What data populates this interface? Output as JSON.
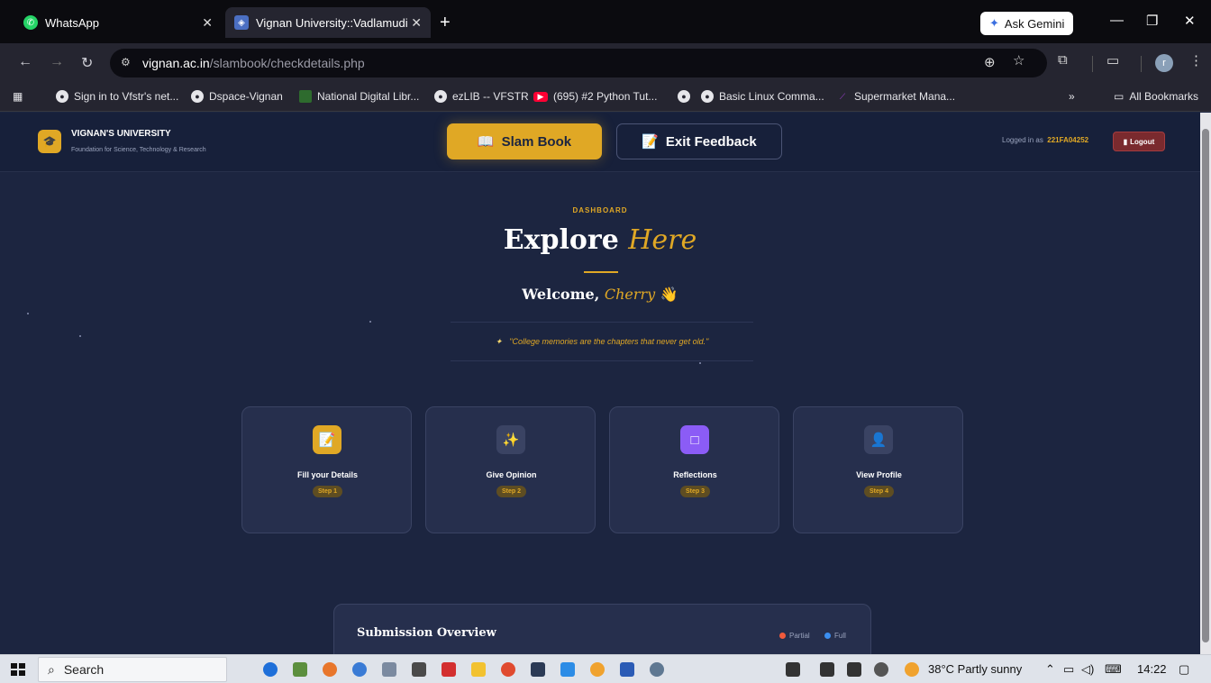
{
  "browser": {
    "tabs": [
      {
        "title": "WhatsApp"
      },
      {
        "title": "Vignan University::Vadlamudi"
      }
    ],
    "gemini_label": "Ask Gemini",
    "url_host": "vignan.ac.in",
    "url_path": "/slambook/checkdetails.php",
    "profile_initial": "r",
    "bookmarks": [
      "Sign in to Vfstr's net...",
      "Dspace-Vignan",
      "National Digital Libr...",
      "ezLIB -- VFSTR",
      "(695) #2 Python Tut...",
      "Basic Linux Comma...",
      "Supermarket Mana..."
    ],
    "all_bookmarks": "All Bookmarks"
  },
  "header": {
    "uni_name": "VIGNAN'S UNIVERSITY",
    "uni_sub": "Foundation for Science, Technology & Research",
    "slam_label": "Slam Book",
    "exit_label": "Exit Feedback",
    "logged_prefix": "Logged in as",
    "user_id": "221FA04252",
    "logout_label": "Logout"
  },
  "hero": {
    "kicker": "DASHBOARD",
    "title_main": "Explore",
    "title_accent": "Here",
    "welcome_prefix": "Welcome,",
    "welcome_name": "Cherry",
    "welcome_emoji": "👋",
    "quote": "\"College memories are the chapters that never get old.\""
  },
  "cards": [
    {
      "title": "Fill your Details",
      "step": "Step 1",
      "icon": "📝",
      "color": "#e0a825"
    },
    {
      "title": "Give Opinion",
      "step": "Step 2",
      "icon": "✨",
      "color": "#3a4363"
    },
    {
      "title": "Reflections",
      "step": "Step 3",
      "icon": "□",
      "color": "#8b5cf6"
    },
    {
      "title": "View Profile",
      "step": "Step 4",
      "icon": "👤",
      "color": "#3a4363"
    }
  ],
  "overview": {
    "title": "Submission Overview",
    "legend": [
      {
        "label": "Partial",
        "color": "#f05a3c"
      },
      {
        "label": "Full",
        "color": "#3b8ef0"
      }
    ]
  },
  "taskbar": {
    "search_label": "Search",
    "weather": "38°C  Partly sunny",
    "time": "14:22"
  }
}
